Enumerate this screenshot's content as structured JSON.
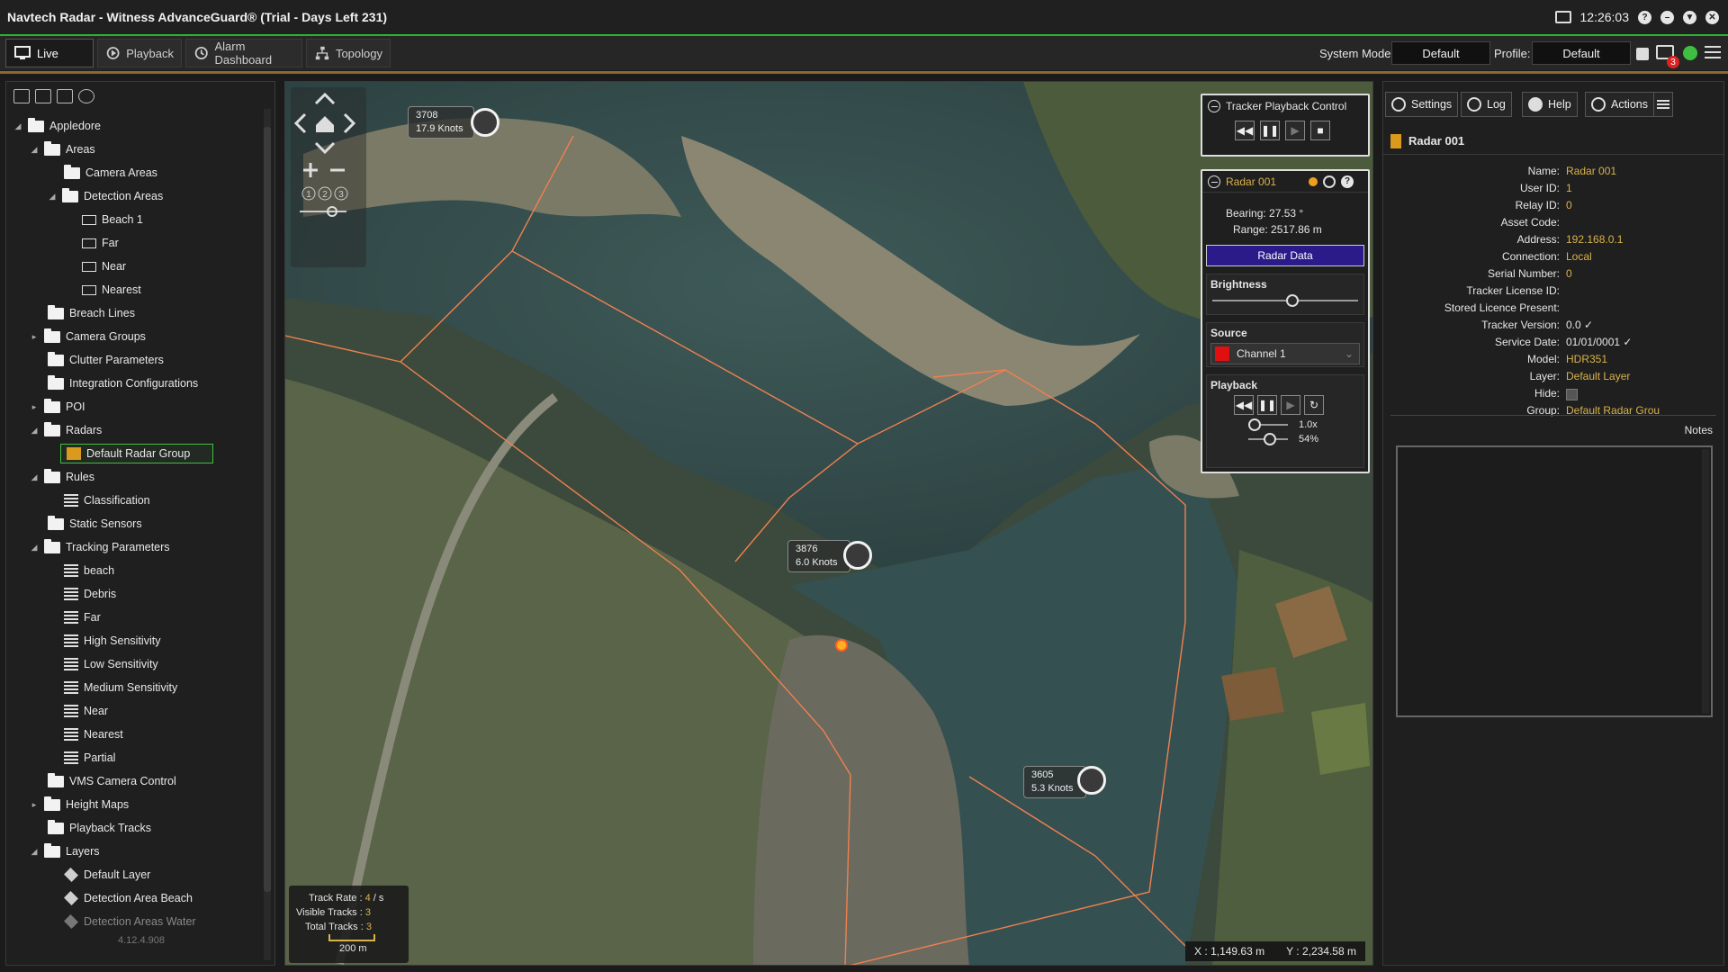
{
  "window": {
    "title": "Navtech Radar - Witness AdvanceGuard® (Trial - Days Left 231)",
    "clock": "12:26:03",
    "alert_count": "3"
  },
  "tabs": [
    {
      "label": "Live"
    },
    {
      "label": "Playback"
    },
    {
      "label": "Alarm Dashboard"
    },
    {
      "label": "Topology"
    }
  ],
  "toolbar": {
    "system_mode_label": "System Mode:",
    "system_mode_value": "Default",
    "profile_label": "Profile:",
    "profile_value": "Default"
  },
  "tree": {
    "items": [
      {
        "label": "Appledore"
      },
      {
        "label": "Areas"
      },
      {
        "label": "Camera Areas"
      },
      {
        "label": "Detection Areas"
      },
      {
        "label": "Beach 1"
      },
      {
        "label": "Far"
      },
      {
        "label": "Near"
      },
      {
        "label": "Nearest"
      },
      {
        "label": "Breach Lines"
      },
      {
        "label": "Camera Groups"
      },
      {
        "label": "Clutter Parameters"
      },
      {
        "label": "Integration Configurations"
      },
      {
        "label": "POI"
      },
      {
        "label": "Radars"
      },
      {
        "label": "Default Radar Group"
      },
      {
        "label": "Rules"
      },
      {
        "label": "Classification"
      },
      {
        "label": "Static Sensors"
      },
      {
        "label": "Tracking Parameters"
      },
      {
        "label": "beach"
      },
      {
        "label": "Debris"
      },
      {
        "label": "Far"
      },
      {
        "label": "High Sensitivity"
      },
      {
        "label": "Low Sensitivity"
      },
      {
        "label": "Medium Sensitivity"
      },
      {
        "label": "Near"
      },
      {
        "label": "Nearest"
      },
      {
        "label": "Partial"
      },
      {
        "label": "VMS Camera Control"
      },
      {
        "label": "Height Maps"
      },
      {
        "label": "Playback Tracks"
      },
      {
        "label": "Layers"
      },
      {
        "label": "Default Layer"
      },
      {
        "label": "Detection Area Beach"
      },
      {
        "label": "Detection Areas Water"
      }
    ],
    "version": "4.12.4.908"
  },
  "map": {
    "tracks": [
      {
        "id": "3708",
        "speed": "17.9 Knots"
      },
      {
        "id": "3876",
        "speed": "6.0 Knots"
      },
      {
        "id": "3605",
        "speed": "5.3 Knots"
      }
    ],
    "zoom_levels": [
      "1",
      "2",
      "3"
    ],
    "stats": {
      "track_rate_label": "Track Rate :",
      "track_rate_value": "4",
      "track_rate_unit": "/ s",
      "visible_label": "Visible Tracks :",
      "visible_value": "3",
      "total_label": "Total Tracks :",
      "total_value": "3",
      "scale": "200 m"
    },
    "coords": {
      "x_label": "X :",
      "x_value": "1,149.63",
      "x_unit": "m",
      "y_label": "Y :",
      "y_value": "2,234.58",
      "y_unit": "m"
    }
  },
  "tracker_playback": {
    "title": "Tracker Playback Control"
  },
  "radar_panel": {
    "title": "Radar 001",
    "bearing_label": "Bearing:",
    "bearing_value": "27.53 °",
    "range_label": "Range:",
    "range_value": "2517.86 m",
    "radar_data_button": "Radar Data",
    "brightness_label": "Brightness",
    "brightness": 0.55,
    "source_label": "Source",
    "source_value": "Channel 1",
    "playback_label": "Playback",
    "speed_value": "1.0x",
    "speed": 0.15,
    "volume_value": "54%",
    "volume": 0.54
  },
  "right_tabs": [
    {
      "label": "Settings"
    },
    {
      "label": "Log"
    },
    {
      "label": "Help"
    },
    {
      "label": "Actions"
    }
  ],
  "details": {
    "header": "Radar 001",
    "props": [
      {
        "k": "Name:",
        "v": "Radar 001",
        "accent": true
      },
      {
        "k": "User ID:",
        "v": "1",
        "accent": true
      },
      {
        "k": "Relay ID:",
        "v": "0",
        "accent": true
      },
      {
        "k": "Asset Code:",
        "v": "",
        "accent": true
      },
      {
        "k": "Address:",
        "v": "192.168.0.1",
        "accent": true
      },
      {
        "k": "Connection:",
        "v": "Local",
        "accent": true
      },
      {
        "k": "Serial Number:",
        "v": "0",
        "accent": true
      },
      {
        "k": "Tracker License ID:",
        "v": "",
        "accent": true
      },
      {
        "k": "Stored Licence Present:",
        "v": "",
        "accent": true
      },
      {
        "k": "Tracker Version:",
        "v": "0.0 ✓",
        "accent": false
      },
      {
        "k": "Service Date:",
        "v": "01/01/0001 ✓",
        "accent": false
      },
      {
        "k": "Model:",
        "v": "HDR351",
        "accent": true
      },
      {
        "k": "Layer:",
        "v": "Default Layer",
        "accent": true
      },
      {
        "k": "Hide:",
        "v": "",
        "accent": true
      },
      {
        "k": "Group:",
        "v": "Default Radar Grou",
        "accent": true
      }
    ],
    "notes_label": "Notes"
  },
  "colors": {
    "accent": "#d9b24a",
    "green": "#30b030",
    "boundary": "#f08050",
    "radar_data": "#2a1a8a"
  }
}
